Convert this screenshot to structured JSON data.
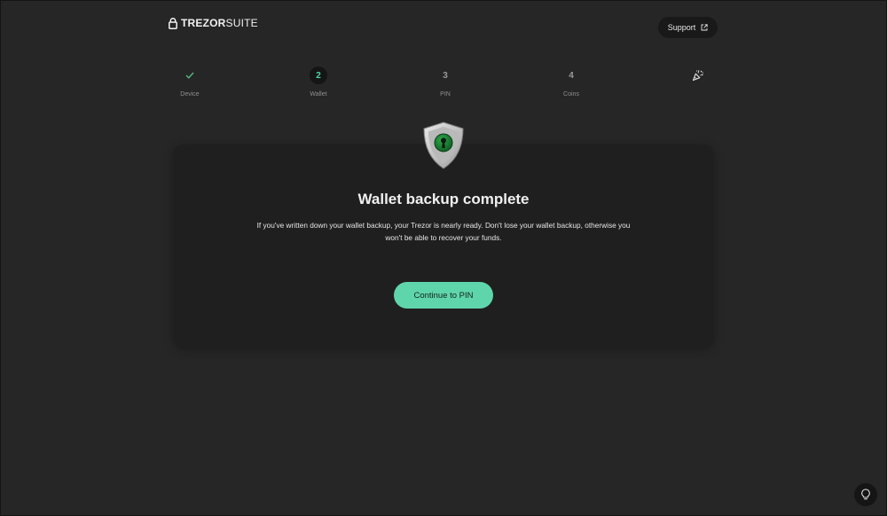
{
  "header": {
    "brand_bold": "TREZOR",
    "brand_light": "SUITE",
    "support_label": "Support"
  },
  "steps": [
    {
      "number": "",
      "label": "Device",
      "state": "done",
      "icon": "check-icon"
    },
    {
      "number": "2",
      "label": "Wallet",
      "state": "active"
    },
    {
      "number": "3",
      "label": "PIN",
      "state": "pending"
    },
    {
      "number": "4",
      "label": "Coins",
      "state": "pending"
    },
    {
      "number": "",
      "label": "",
      "state": "pending",
      "icon": "party-popper-icon"
    }
  ],
  "card": {
    "title": "Wallet backup complete",
    "description": "If you've written down your wallet backup, your Trezor is nearly ready. Don't lose your wallet backup, otherwise you won't be able to recover your funds.",
    "continue_label": "Continue to PIN",
    "illustration": "shield-lock-icon"
  },
  "colors": {
    "accent": "#5fd5ab",
    "active_step": "#4fd6a5",
    "background": "#262626",
    "card": "#1f1f1f"
  }
}
